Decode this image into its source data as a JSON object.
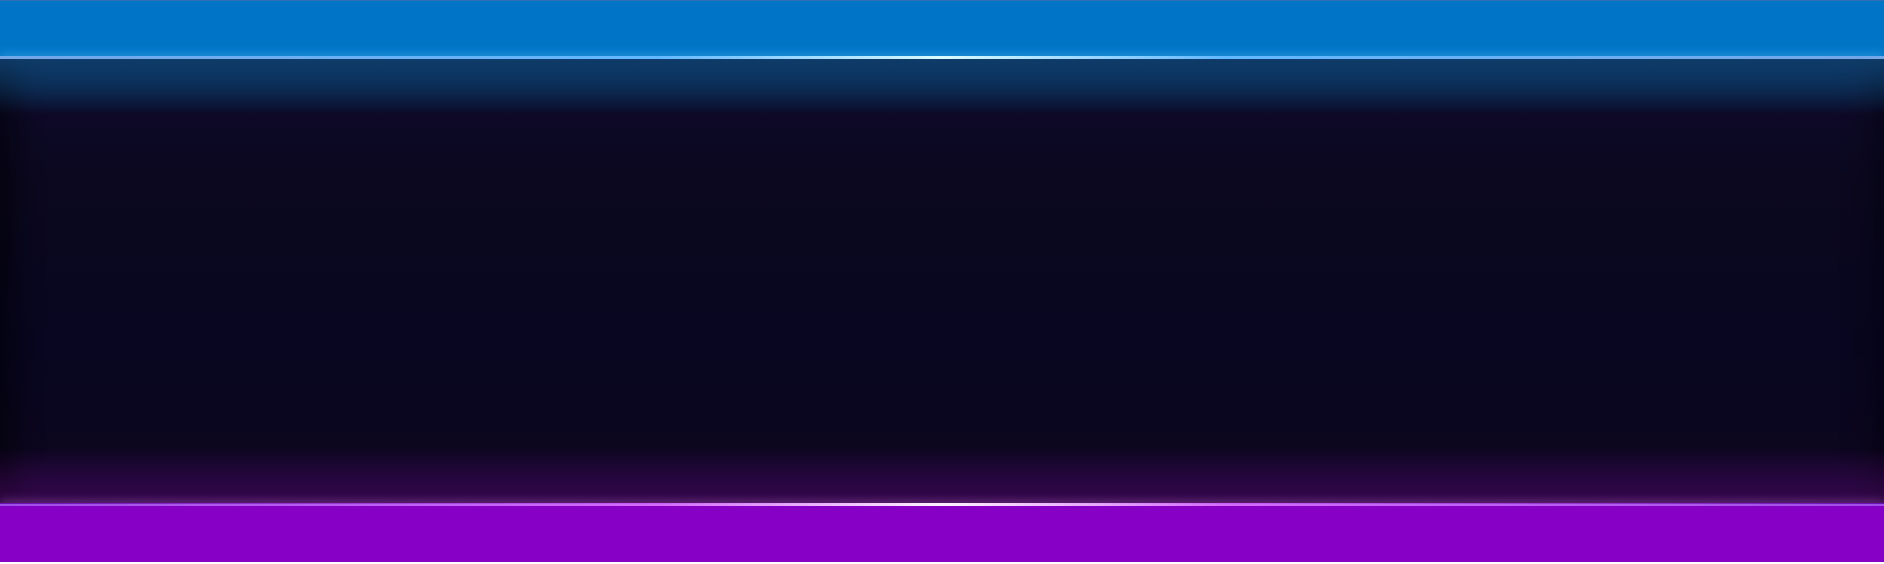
{
  "colors": {
    "top_bar": "#0075c7",
    "bottom_bar": "#8700c6",
    "panel_dark": "#080620"
  }
}
